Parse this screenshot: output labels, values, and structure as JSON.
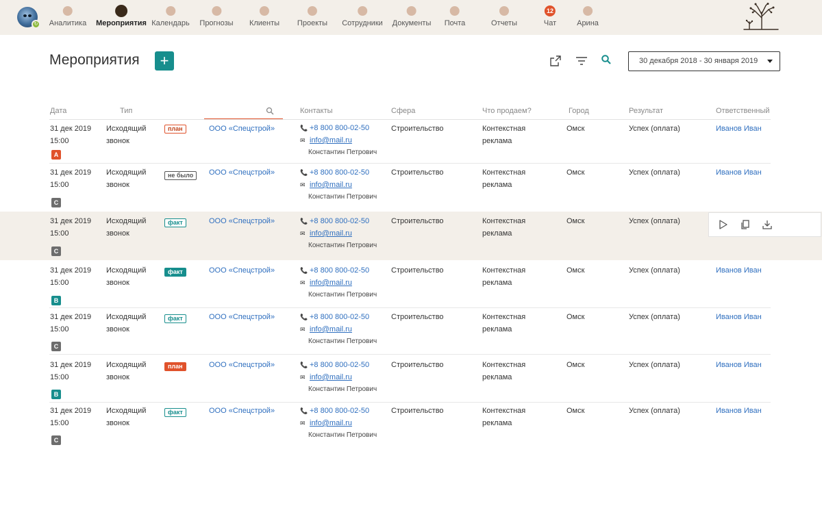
{
  "nav": {
    "items": [
      {
        "label": "Аналитика"
      },
      {
        "label": "Мероприятия"
      },
      {
        "label": "Календарь"
      },
      {
        "label": "Прогнозы"
      },
      {
        "label": "Клиенты"
      },
      {
        "label": "Проекты"
      },
      {
        "label": "Сотрудники"
      },
      {
        "label": "Документы"
      },
      {
        "label": "Почта"
      },
      {
        "label": "Отчеты"
      },
      {
        "label": "Чат",
        "count": "12"
      },
      {
        "label": "Арина"
      }
    ],
    "active": "Мероприятия"
  },
  "page": {
    "title": "Мероприятия",
    "add_label": "+",
    "date_range": "30 декабря 2018 - 30 января 2019"
  },
  "table": {
    "headers": {
      "date": "Дата",
      "type": "Тип",
      "contacts": "Контакты",
      "sphere": "Сфера",
      "sell": "Что продаем?",
      "city": "Город",
      "result": "Результат",
      "responsible": "Ответственный"
    },
    "rows": [
      {
        "date": "31 дек 2019",
        "time": "15:00",
        "grade": "A",
        "type1": "Исходящий",
        "type2": "звонок",
        "status": "план",
        "status_style": "plan",
        "company": "ООО «Спецстрой»",
        "phone": "+8 800 800-02-50",
        "email": "info@mail.ru",
        "person": "Константин Петрович",
        "sphere": "Строительство",
        "sell1": "Контекстная",
        "sell2": "реклама",
        "city": "Омск",
        "result": "Успех (оплата)",
        "responsible": "Иванов Иван"
      },
      {
        "date": "31 дек 2019",
        "time": "15:00",
        "grade": "C",
        "type1": "Исходящий",
        "type2": "звонок",
        "status": "не было",
        "status_style": "noshow",
        "company": "ООО «Спецстрой»",
        "phone": "+8 800 800-02-50",
        "email": "info@mail.ru",
        "person": "Константин Петрович",
        "sphere": "Строительство",
        "sell1": "Контекстная",
        "sell2": "реклама",
        "city": "Омск",
        "result": "Успех (оплата)",
        "responsible": "Иванов Иван"
      },
      {
        "date": "31 дек 2019",
        "time": "15:00",
        "grade": "C",
        "type1": "Исходящий",
        "type2": "звонок",
        "status": "факт",
        "status_style": "fact",
        "company": "ООО «Спецстрой»",
        "phone": "+8 800 800-02-50",
        "email": "info@mail.ru",
        "person": "Константин Петрович",
        "sphere": "Строительство",
        "sell1": "Контекстная",
        "sell2": "реклама",
        "city": "Омск",
        "result": "Успех (оплата)",
        "responsible": ""
      },
      {
        "date": "31 дек 2019",
        "time": "15:00",
        "grade": "B",
        "type1": "Исходящий",
        "type2": "звонок",
        "status": "факт",
        "status_style": "fact-filled",
        "company": "ООО «Спецстрой»",
        "phone": "+8 800 800-02-50",
        "email": "info@mail.ru",
        "person": "Константин Петрович",
        "sphere": "Строительство",
        "sell1": "Контекстная",
        "sell2": "реклама",
        "city": "Омск",
        "result": "Успех (оплата)",
        "responsible": "Иванов Иван"
      },
      {
        "date": "31 дек 2019",
        "time": "15:00",
        "grade": "C",
        "type1": "Исходящий",
        "type2": "звонок",
        "status": "факт",
        "status_style": "fact",
        "company": "ООО «Спецстрой»",
        "phone": "+8 800 800-02-50",
        "email": "info@mail.ru",
        "person": "Константин Петрович",
        "sphere": "Строительство",
        "sell1": "Контекстная",
        "sell2": "реклама",
        "city": "Омск",
        "result": "Успех (оплата)",
        "responsible": "Иванов Иван"
      },
      {
        "date": "31 дек 2019",
        "time": "15:00",
        "grade": "B",
        "type1": "Исходящий",
        "type2": "звонок",
        "status": "план",
        "status_style": "plan-filled",
        "company": "ООО «Спецстрой»",
        "phone": "+8 800 800-02-50",
        "email": "info@mail.ru",
        "person": "Константин Петрович",
        "sphere": "Строительство",
        "sell1": "Контекстная",
        "sell2": "реклама",
        "city": "Омск",
        "result": "Успех (оплата)",
        "responsible": "Иванов Иван"
      },
      {
        "date": "31 дек 2019",
        "time": "15:00",
        "grade": "C",
        "type1": "Исходящий",
        "type2": "звонок",
        "status": "факт",
        "status_style": "fact",
        "company": "ООО «Спецстрой»",
        "phone": "+8 800 800-02-50",
        "email": "info@mail.ru",
        "person": "Константин Петрович",
        "sphere": "Строительство",
        "sell1": "Контекстная",
        "sell2": "реклама",
        "city": "Омск",
        "result": "Успех (оплата)",
        "responsible": "Иванов Иван"
      }
    ]
  },
  "icons": {
    "export": "export-icon",
    "filter": "filter-icon",
    "search": "search-icon",
    "row_actions": [
      "play-icon",
      "copy-icon",
      "download-icon"
    ]
  },
  "colors": {
    "accent": "#178e8d",
    "alert": "#e0522b",
    "link": "#2f6fbf",
    "topbar": "#f3efe9"
  }
}
